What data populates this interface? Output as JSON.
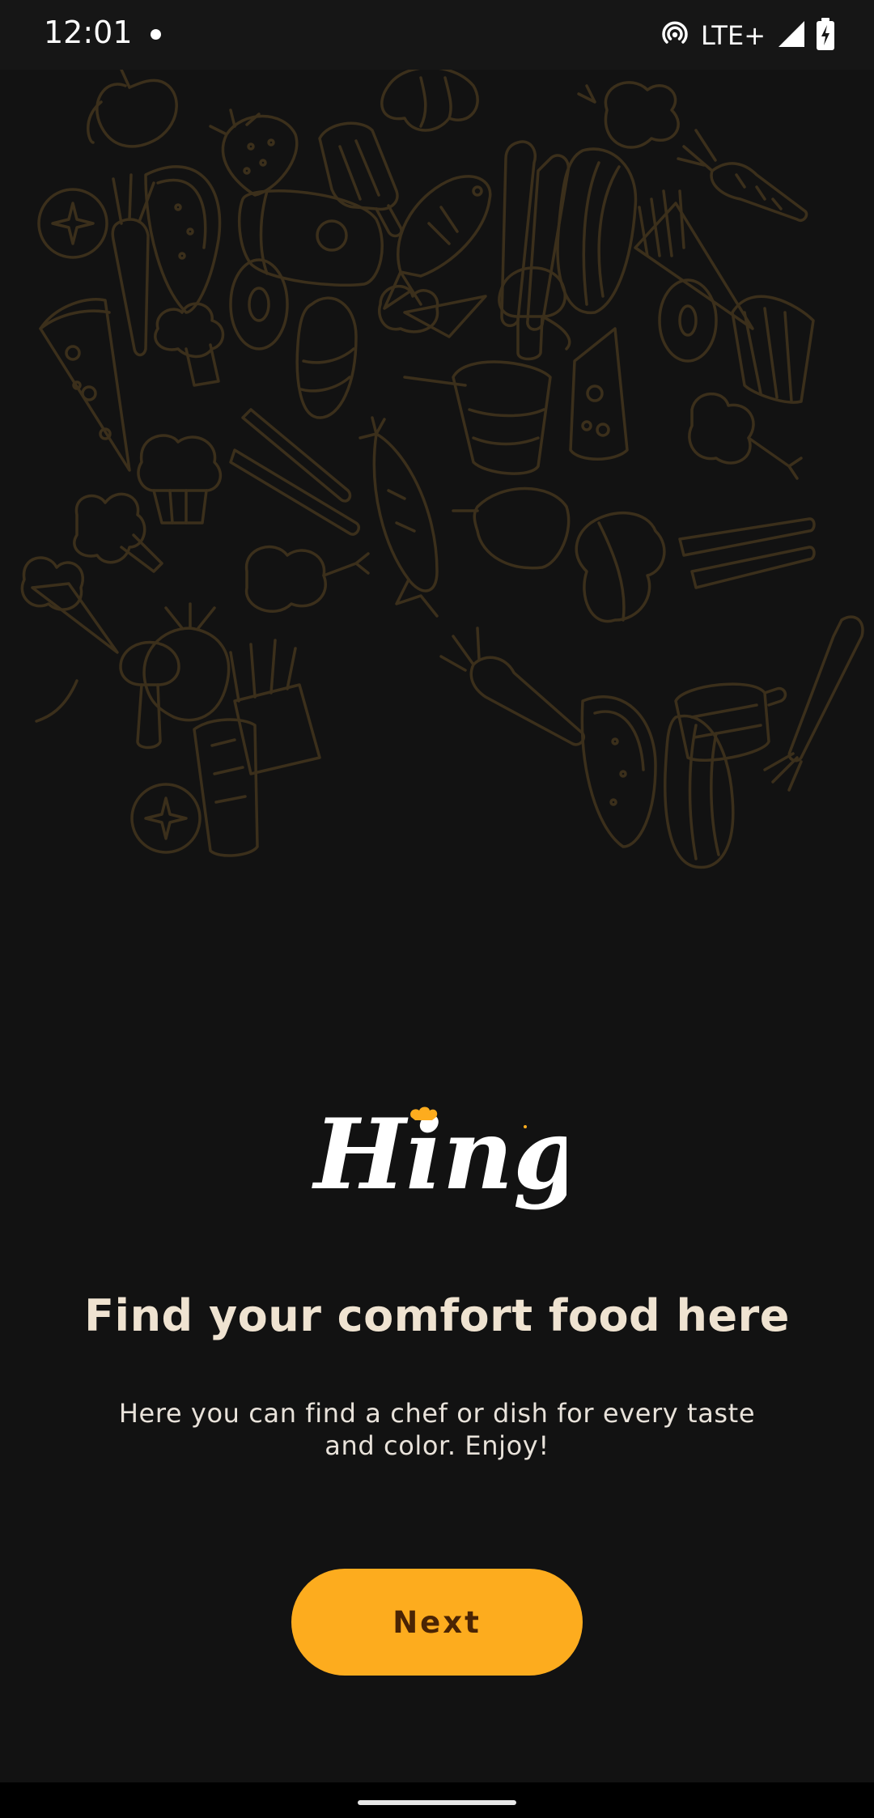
{
  "status_bar": {
    "time": "12:01",
    "network": "LTE+",
    "icons": [
      "notification-dot-icon",
      "hotspot-icon",
      "signal-icon",
      "battery-charging-icon"
    ]
  },
  "background": {
    "description_icon": "food-doodle-pattern",
    "stroke_color": "#3b2f1b"
  },
  "logo": {
    "text": "Hing",
    "accent_color": "#fdac1e"
  },
  "onboarding": {
    "title": "Find your comfort food here",
    "subtitle": "Here you can find a chef or dish for every taste and color. Enjoy!",
    "next_label": "Next"
  },
  "colors": {
    "background": "#121212",
    "title": "#efe3d1",
    "button": "#fdac1e",
    "button_text": "#4a2404"
  }
}
